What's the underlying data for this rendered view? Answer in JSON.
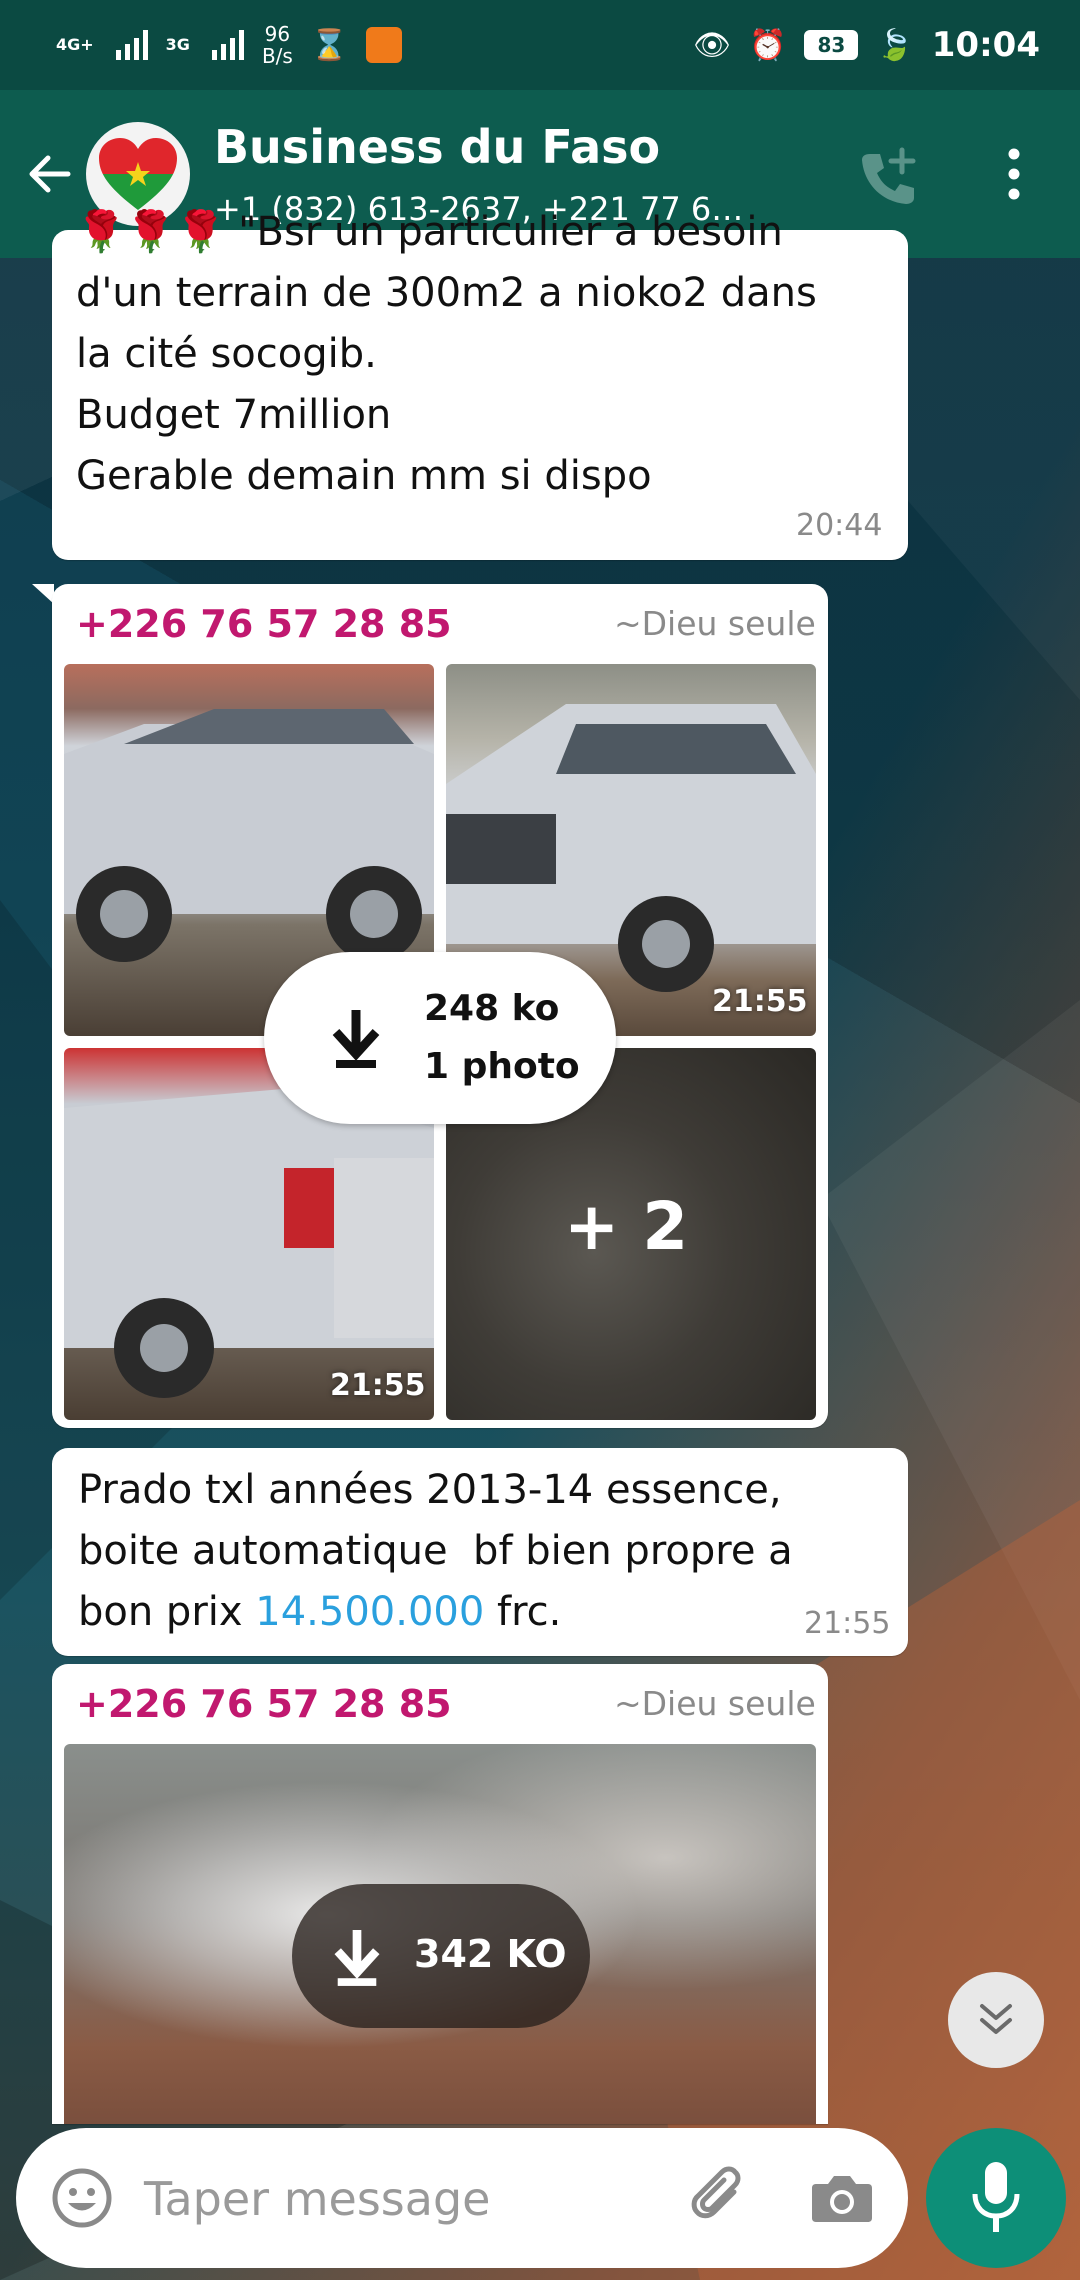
{
  "status_bar": {
    "network_1": "4G+",
    "network_2": "3G",
    "speed_value": "96",
    "speed_unit": "B/s",
    "battery": "83",
    "time": "10:04"
  },
  "header": {
    "title": "Business du Faso",
    "subtitle": "+1 (832) 613-2637, +221 77 6…"
  },
  "messages": {
    "m1": {
      "lines": [
        "\"Bsr un particulier a besoin",
        "d'un terrain de 300m2 a nioko2 dans",
        "la cité socogib.",
        "Budget 7million",
        "Gerable demain mm si dispo"
      ],
      "time": "20:44"
    },
    "m2": {
      "sender": "+226 76 57 28 85",
      "alias": "~Dieu seule",
      "download_size": "248 ko",
      "download_count": "1 photo",
      "photo_time_1": "21:55",
      "photo_time_2": "21:55",
      "more_count": "+ 2"
    },
    "m3": {
      "line1": "Prado txl années 2013-14 essence,",
      "line2": "boite automatique  bf bien propre a",
      "line3_prefix": "bon prix ",
      "price": "14.500.000",
      "line3_suffix": " frc.",
      "time": "21:55"
    },
    "m4": {
      "sender": "+226 76 57 28 85",
      "alias": "~Dieu seule",
      "download_size": "342 KO"
    }
  },
  "composer": {
    "placeholder": "Taper message"
  }
}
